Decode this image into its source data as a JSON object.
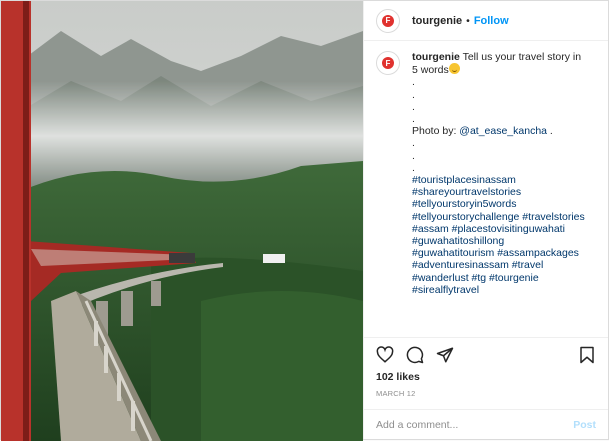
{
  "photo": {
    "description_icon": "train-photo"
  },
  "header": {
    "username": "tourgenie",
    "separator": "•",
    "follow_label": "Follow"
  },
  "caption": {
    "username": "tourgenie",
    "lines": [
      "Tell us your travel story in",
      "5 words"
    ],
    "dots_a": [
      ".",
      ".",
      ".",
      "."
    ],
    "photo_by_label": "Photo by: ",
    "photo_by_handle": "@at_ease_kancha",
    "photo_by_suffix": " .",
    "dots_b": [
      ".",
      ".",
      "."
    ],
    "hashtag_lines": [
      "#touristplacesinassam",
      "#shareyourtravelstories",
      "#tellyourstoryin5words",
      "#tellyourstorychallenge #travelstories",
      "#assam #placestovisitinguwahati",
      "#guwahatitoshillong",
      "#guwahatitourism #assampackages",
      "#adventuresinassam #travel",
      "#wanderlust #tg #tourgenie",
      "#sirealflytravel"
    ]
  },
  "actions": {
    "like": "heart-icon",
    "comment": "comment-icon",
    "share": "share-icon",
    "save": "bookmark-icon"
  },
  "likes": "102 likes",
  "date": "MARCH 12",
  "add_comment": {
    "placeholder": "Add a comment...",
    "post_label": "Post"
  },
  "colors": {
    "follow": "#0095f6",
    "hashtag": "#00376b",
    "brand": "#e0322f",
    "post_disabled": "#b2dffc"
  }
}
